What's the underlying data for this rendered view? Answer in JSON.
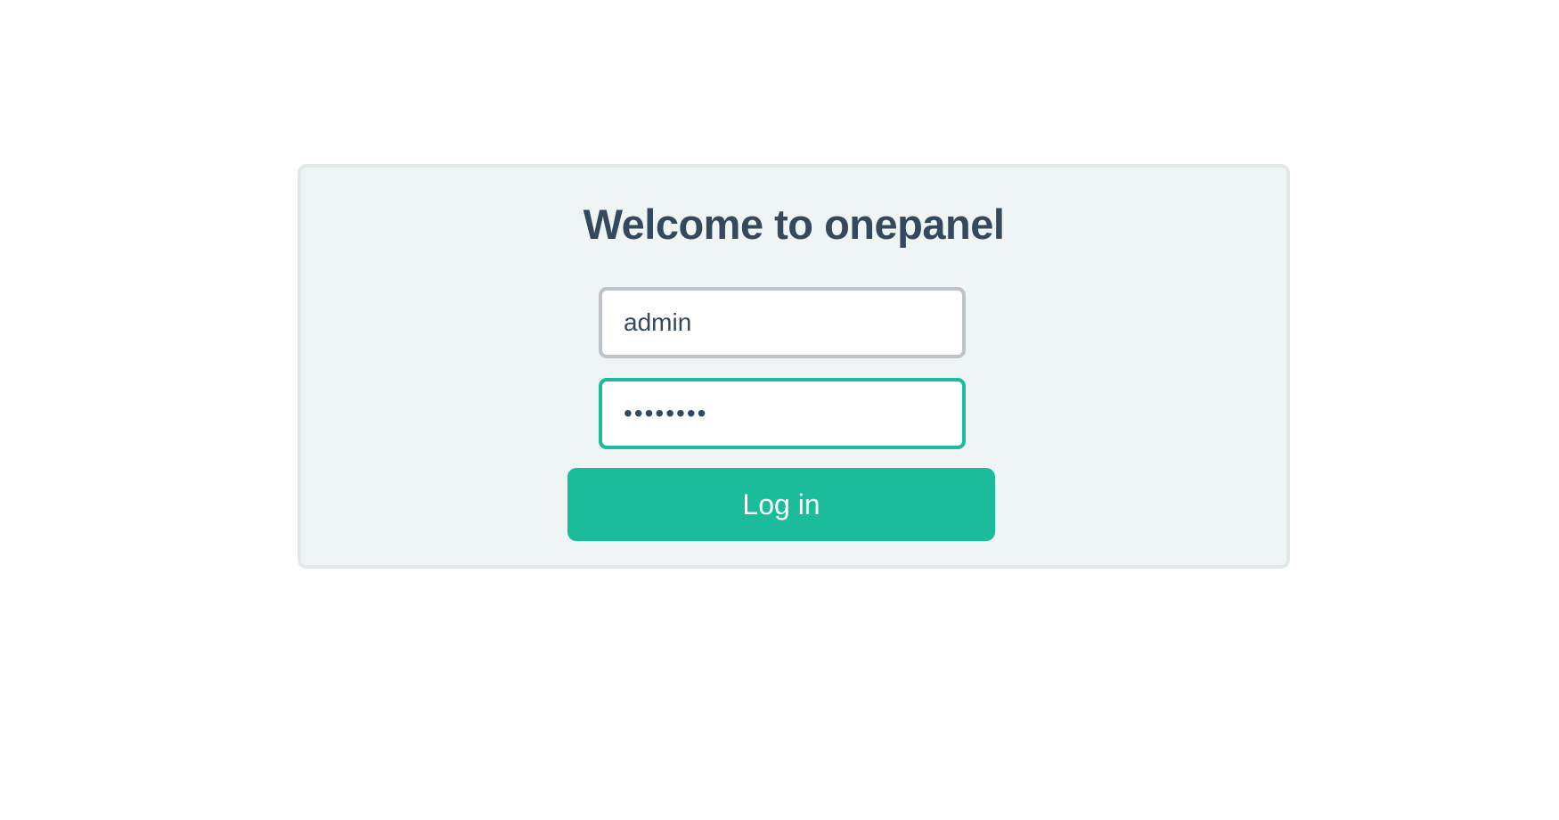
{
  "login": {
    "title": "Welcome to onepanel",
    "username": {
      "value": "admin"
    },
    "password": {
      "value": "••••••••"
    },
    "submit_label": "Log in"
  },
  "colors": {
    "accent": "#1abc9c",
    "text": "#34495e",
    "panel_background": "#eef5f4",
    "panel_border": "#e1e9e8",
    "input_border": "#bdc3c7"
  }
}
